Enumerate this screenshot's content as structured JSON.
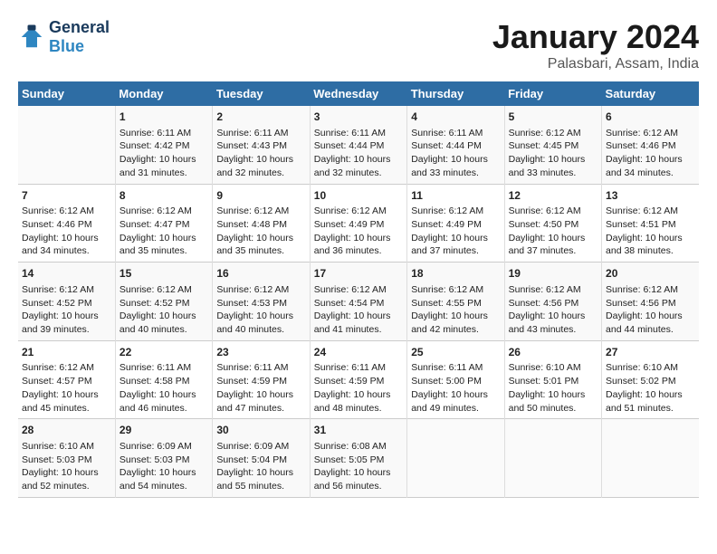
{
  "header": {
    "logo_line1": "General",
    "logo_line2": "Blue",
    "month": "January 2024",
    "location": "Palasbari, Assam, India"
  },
  "weekdays": [
    "Sunday",
    "Monday",
    "Tuesday",
    "Wednesday",
    "Thursday",
    "Friday",
    "Saturday"
  ],
  "weeks": [
    [
      {
        "day": "",
        "sunrise": "",
        "sunset": "",
        "daylight": ""
      },
      {
        "day": "1",
        "sunrise": "Sunrise: 6:11 AM",
        "sunset": "Sunset: 4:42 PM",
        "daylight": "Daylight: 10 hours and 31 minutes."
      },
      {
        "day": "2",
        "sunrise": "Sunrise: 6:11 AM",
        "sunset": "Sunset: 4:43 PM",
        "daylight": "Daylight: 10 hours and 32 minutes."
      },
      {
        "day": "3",
        "sunrise": "Sunrise: 6:11 AM",
        "sunset": "Sunset: 4:44 PM",
        "daylight": "Daylight: 10 hours and 32 minutes."
      },
      {
        "day": "4",
        "sunrise": "Sunrise: 6:11 AM",
        "sunset": "Sunset: 4:44 PM",
        "daylight": "Daylight: 10 hours and 33 minutes."
      },
      {
        "day": "5",
        "sunrise": "Sunrise: 6:12 AM",
        "sunset": "Sunset: 4:45 PM",
        "daylight": "Daylight: 10 hours and 33 minutes."
      },
      {
        "day": "6",
        "sunrise": "Sunrise: 6:12 AM",
        "sunset": "Sunset: 4:46 PM",
        "daylight": "Daylight: 10 hours and 34 minutes."
      }
    ],
    [
      {
        "day": "7",
        "sunrise": "Sunrise: 6:12 AM",
        "sunset": "Sunset: 4:46 PM",
        "daylight": "Daylight: 10 hours and 34 minutes."
      },
      {
        "day": "8",
        "sunrise": "Sunrise: 6:12 AM",
        "sunset": "Sunset: 4:47 PM",
        "daylight": "Daylight: 10 hours and 35 minutes."
      },
      {
        "day": "9",
        "sunrise": "Sunrise: 6:12 AM",
        "sunset": "Sunset: 4:48 PM",
        "daylight": "Daylight: 10 hours and 35 minutes."
      },
      {
        "day": "10",
        "sunrise": "Sunrise: 6:12 AM",
        "sunset": "Sunset: 4:49 PM",
        "daylight": "Daylight: 10 hours and 36 minutes."
      },
      {
        "day": "11",
        "sunrise": "Sunrise: 6:12 AM",
        "sunset": "Sunset: 4:49 PM",
        "daylight": "Daylight: 10 hours and 37 minutes."
      },
      {
        "day": "12",
        "sunrise": "Sunrise: 6:12 AM",
        "sunset": "Sunset: 4:50 PM",
        "daylight": "Daylight: 10 hours and 37 minutes."
      },
      {
        "day": "13",
        "sunrise": "Sunrise: 6:12 AM",
        "sunset": "Sunset: 4:51 PM",
        "daylight": "Daylight: 10 hours and 38 minutes."
      }
    ],
    [
      {
        "day": "14",
        "sunrise": "Sunrise: 6:12 AM",
        "sunset": "Sunset: 4:52 PM",
        "daylight": "Daylight: 10 hours and 39 minutes."
      },
      {
        "day": "15",
        "sunrise": "Sunrise: 6:12 AM",
        "sunset": "Sunset: 4:52 PM",
        "daylight": "Daylight: 10 hours and 40 minutes."
      },
      {
        "day": "16",
        "sunrise": "Sunrise: 6:12 AM",
        "sunset": "Sunset: 4:53 PM",
        "daylight": "Daylight: 10 hours and 40 minutes."
      },
      {
        "day": "17",
        "sunrise": "Sunrise: 6:12 AM",
        "sunset": "Sunset: 4:54 PM",
        "daylight": "Daylight: 10 hours and 41 minutes."
      },
      {
        "day": "18",
        "sunrise": "Sunrise: 6:12 AM",
        "sunset": "Sunset: 4:55 PM",
        "daylight": "Daylight: 10 hours and 42 minutes."
      },
      {
        "day": "19",
        "sunrise": "Sunrise: 6:12 AM",
        "sunset": "Sunset: 4:56 PM",
        "daylight": "Daylight: 10 hours and 43 minutes."
      },
      {
        "day": "20",
        "sunrise": "Sunrise: 6:12 AM",
        "sunset": "Sunset: 4:56 PM",
        "daylight": "Daylight: 10 hours and 44 minutes."
      }
    ],
    [
      {
        "day": "21",
        "sunrise": "Sunrise: 6:12 AM",
        "sunset": "Sunset: 4:57 PM",
        "daylight": "Daylight: 10 hours and 45 minutes."
      },
      {
        "day": "22",
        "sunrise": "Sunrise: 6:11 AM",
        "sunset": "Sunset: 4:58 PM",
        "daylight": "Daylight: 10 hours and 46 minutes."
      },
      {
        "day": "23",
        "sunrise": "Sunrise: 6:11 AM",
        "sunset": "Sunset: 4:59 PM",
        "daylight": "Daylight: 10 hours and 47 minutes."
      },
      {
        "day": "24",
        "sunrise": "Sunrise: 6:11 AM",
        "sunset": "Sunset: 4:59 PM",
        "daylight": "Daylight: 10 hours and 48 minutes."
      },
      {
        "day": "25",
        "sunrise": "Sunrise: 6:11 AM",
        "sunset": "Sunset: 5:00 PM",
        "daylight": "Daylight: 10 hours and 49 minutes."
      },
      {
        "day": "26",
        "sunrise": "Sunrise: 6:10 AM",
        "sunset": "Sunset: 5:01 PM",
        "daylight": "Daylight: 10 hours and 50 minutes."
      },
      {
        "day": "27",
        "sunrise": "Sunrise: 6:10 AM",
        "sunset": "Sunset: 5:02 PM",
        "daylight": "Daylight: 10 hours and 51 minutes."
      }
    ],
    [
      {
        "day": "28",
        "sunrise": "Sunrise: 6:10 AM",
        "sunset": "Sunset: 5:03 PM",
        "daylight": "Daylight: 10 hours and 52 minutes."
      },
      {
        "day": "29",
        "sunrise": "Sunrise: 6:09 AM",
        "sunset": "Sunset: 5:03 PM",
        "daylight": "Daylight: 10 hours and 54 minutes."
      },
      {
        "day": "30",
        "sunrise": "Sunrise: 6:09 AM",
        "sunset": "Sunset: 5:04 PM",
        "daylight": "Daylight: 10 hours and 55 minutes."
      },
      {
        "day": "31",
        "sunrise": "Sunrise: 6:08 AM",
        "sunset": "Sunset: 5:05 PM",
        "daylight": "Daylight: 10 hours and 56 minutes."
      },
      {
        "day": "",
        "sunrise": "",
        "sunset": "",
        "daylight": ""
      },
      {
        "day": "",
        "sunrise": "",
        "sunset": "",
        "daylight": ""
      },
      {
        "day": "",
        "sunrise": "",
        "sunset": "",
        "daylight": ""
      }
    ]
  ]
}
